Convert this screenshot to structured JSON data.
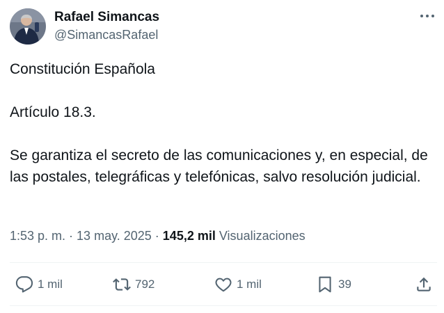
{
  "author": {
    "name": "Rafael Simancas",
    "handle": "@SimancasRafael"
  },
  "post": {
    "line1": "Constitución Española",
    "line2": "Artículo 18.3.",
    "line3": "Se garantiza el secreto de las comunicaciones y, en especial, de las postales, telegráficas y telefónicas, salvo resolución judicial."
  },
  "meta": {
    "time": "1:53 p. m.",
    "sep1": " · ",
    "date": "13 may. 2025",
    "sep2": " · ",
    "views_count": "145,2 mil",
    "views_label": "Visualizaciones"
  },
  "actions": {
    "replies": "1 mil",
    "reposts": "792",
    "likes": "1 mil",
    "bookmarks": "39"
  },
  "icons": {
    "more": "more-dots-icon",
    "reply": "reply-icon",
    "repost": "repost-icon",
    "like": "heart-icon",
    "bookmark": "bookmark-icon",
    "share": "share-icon"
  },
  "colors": {
    "text": "#0f1419",
    "secondary": "#536471",
    "divider": "#eff3f4"
  }
}
